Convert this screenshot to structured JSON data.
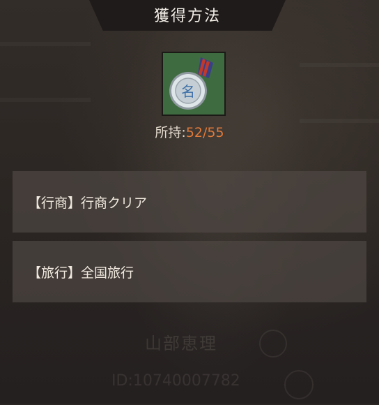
{
  "header": {
    "title": "獲得方法"
  },
  "item": {
    "icon": "medal-icon",
    "medal_char": "名",
    "owned_label": "所持",
    "owned_colon": ":",
    "owned_count": "52/55"
  },
  "methods": [
    {
      "label": "【行商】行商クリア"
    },
    {
      "label": "【旅行】全国旅行"
    }
  ],
  "background": {
    "name": "山部恵理",
    "id": "ID:10740007782"
  },
  "colors": {
    "count": "#e07a3a",
    "frame": "#3f6b40",
    "row": "#4e4642"
  }
}
